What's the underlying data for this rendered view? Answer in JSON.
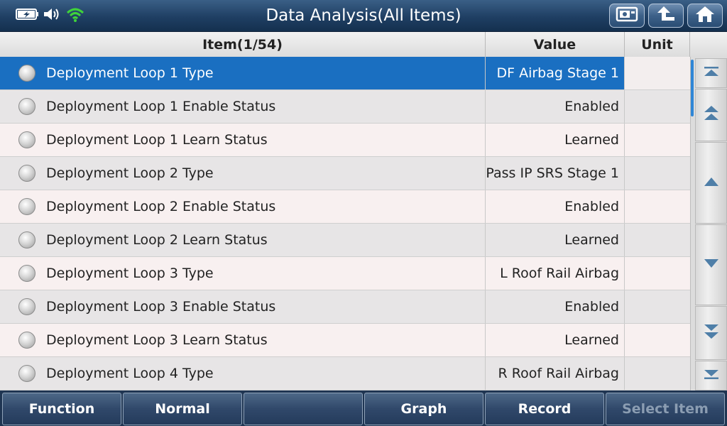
{
  "window": {
    "title": "Data Analysis(All Items)"
  },
  "status_icons": [
    "battery-charging-icon",
    "speaker-icon",
    "wifi-icon"
  ],
  "header_buttons": [
    "screenshot-icon",
    "back-icon",
    "home-icon"
  ],
  "table": {
    "headers": {
      "item": "Item(1/54)",
      "value": "Value",
      "unit": "Unit"
    },
    "rows": [
      {
        "item": "Deployment Loop 1 Type",
        "value": "DF Airbag Stage 1",
        "unit": "",
        "selected": true
      },
      {
        "item": "Deployment Loop 1 Enable Status",
        "value": "Enabled",
        "unit": ""
      },
      {
        "item": "Deployment Loop 1 Learn Status",
        "value": "Learned",
        "unit": ""
      },
      {
        "item": "Deployment Loop 2 Type",
        "value": "Pass IP SRS Stage 1",
        "unit": ""
      },
      {
        "item": "Deployment Loop 2 Enable Status",
        "value": "Enabled",
        "unit": ""
      },
      {
        "item": "Deployment Loop 2 Learn Status",
        "value": "Learned",
        "unit": ""
      },
      {
        "item": "Deployment Loop 3 Type",
        "value": "L Roof Rail Airbag",
        "unit": ""
      },
      {
        "item": "Deployment Loop 3 Enable Status",
        "value": "Enabled",
        "unit": ""
      },
      {
        "item": "Deployment Loop 3 Learn Status",
        "value": "Learned",
        "unit": ""
      },
      {
        "item": "Deployment Loop 4 Type",
        "value": "R Roof Rail Airbag",
        "unit": ""
      }
    ]
  },
  "scroll_buttons": [
    "scroll-top-icon",
    "page-up-icon",
    "line-up-icon",
    "line-down-icon",
    "page-down-icon",
    "scroll-bottom-icon"
  ],
  "bottom_bar": {
    "function": "Function",
    "normal": "Normal",
    "blank": "",
    "graph": "Graph",
    "record": "Record",
    "select_item": "Select Item"
  },
  "colors": {
    "selected_row": "#1a6fc1",
    "title_bar": "#1f3f63",
    "bottom_bar": "#1f3552"
  }
}
